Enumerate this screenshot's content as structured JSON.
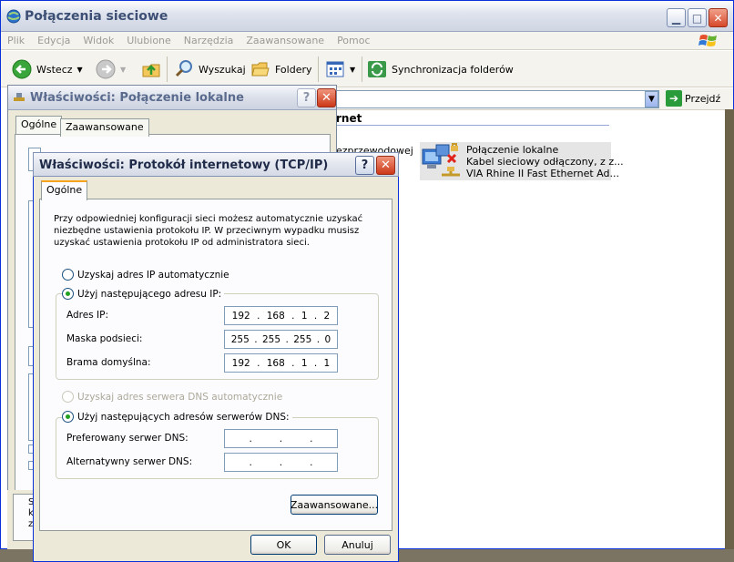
{
  "window": {
    "title": "Połączenia sieciowe",
    "menu": [
      "Plik",
      "Edycja",
      "Widok",
      "Ulubione",
      "Narzędzia",
      "Zaawansowane",
      "Pomoc"
    ],
    "toolbar": {
      "back": "Wstecz",
      "search": "Wyszukaj",
      "folders": "Foldery",
      "sync": "Synchronizacja folderów"
    },
    "address": {
      "go": "Przejdź"
    },
    "content": {
      "heading_fragment": "rnet",
      "left_fragment": "ezprzewodowej",
      "connection": {
        "name": "Połączenie lokalne",
        "status": "Kabel sieciowy odłączony, z z...",
        "device": "VIA Rhine II Fast Ethernet Ad..."
      }
    }
  },
  "dialog_lan": {
    "title": "Właściwości: Połączenie lokalne",
    "tabs": [
      "Ogólne",
      "Zaawansowane"
    ],
    "help": "?",
    "close": "✕",
    "bottom_fragment": "S\nk\nz"
  },
  "dialog_tcpip": {
    "title": "Właściwości: Protokół internetowy (TCP/IP)",
    "help": "?",
    "close": "✕",
    "tab": "Ogólne",
    "intro": "Przy odpowiedniej konfiguracji sieci możesz automatycznie uzyskać niezbędne ustawienia protokołu IP. W przeciwnym wypadku musisz uzyskać ustawienia protokołu IP od administratora sieci.",
    "ip_auto": "Uzyskaj adres IP automatycznie",
    "ip_manual": "Użyj następującego adresu IP:",
    "ip_selected": "manual",
    "fields": {
      "ip_label": "Adres IP:",
      "ip": [
        "192",
        "168",
        "1",
        "2"
      ],
      "mask_label": "Maska podsieci:",
      "mask": [
        "255",
        "255",
        "255",
        "0"
      ],
      "gateway_label": "Brama domyślna:",
      "gateway": [
        "192",
        "168",
        "1",
        "1"
      ]
    },
    "dns_auto": "Uzyskaj adres serwera DNS automatycznie",
    "dns_manual": "Użyj następujących adresów serwerów DNS:",
    "dns_selected": "manual",
    "dns": {
      "preferred_label": "Preferowany serwer DNS:",
      "preferred": [
        "",
        "",
        "",
        ""
      ],
      "alternate_label": "Alternatywny serwer DNS:",
      "alternate": [
        "",
        "",
        "",
        ""
      ]
    },
    "advanced_button": "Zaawansowane...",
    "ok_button": "OK",
    "cancel_button": "Anuluj"
  },
  "colors": {
    "xp_blue_border": "#0831d9",
    "dialog_face": "#ece9d8",
    "radio_selected": "#21a121"
  }
}
